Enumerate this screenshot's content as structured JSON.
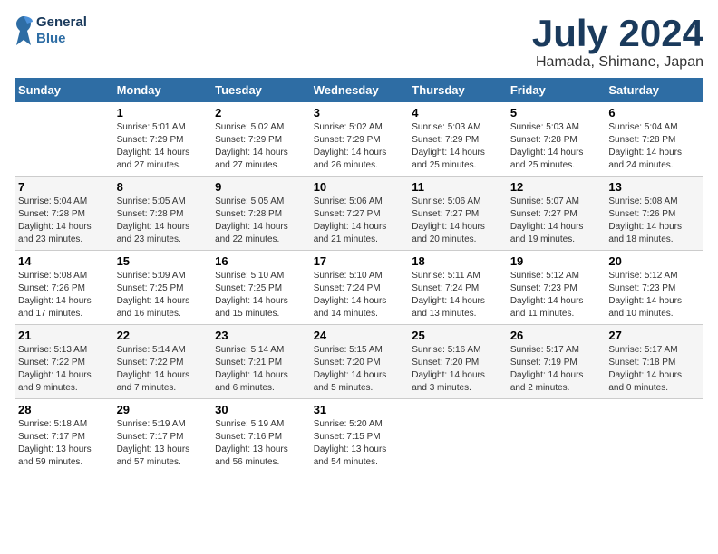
{
  "header": {
    "logo_line1": "General",
    "logo_line2": "Blue",
    "month_year": "July 2024",
    "location": "Hamada, Shimane, Japan"
  },
  "columns": [
    "Sunday",
    "Monday",
    "Tuesday",
    "Wednesday",
    "Thursday",
    "Friday",
    "Saturday"
  ],
  "weeks": [
    [
      {
        "day": "",
        "info": ""
      },
      {
        "day": "1",
        "info": "Sunrise: 5:01 AM\nSunset: 7:29 PM\nDaylight: 14 hours\nand 27 minutes."
      },
      {
        "day": "2",
        "info": "Sunrise: 5:02 AM\nSunset: 7:29 PM\nDaylight: 14 hours\nand 27 minutes."
      },
      {
        "day": "3",
        "info": "Sunrise: 5:02 AM\nSunset: 7:29 PM\nDaylight: 14 hours\nand 26 minutes."
      },
      {
        "day": "4",
        "info": "Sunrise: 5:03 AM\nSunset: 7:29 PM\nDaylight: 14 hours\nand 25 minutes."
      },
      {
        "day": "5",
        "info": "Sunrise: 5:03 AM\nSunset: 7:28 PM\nDaylight: 14 hours\nand 25 minutes."
      },
      {
        "day": "6",
        "info": "Sunrise: 5:04 AM\nSunset: 7:28 PM\nDaylight: 14 hours\nand 24 minutes."
      }
    ],
    [
      {
        "day": "7",
        "info": "Sunrise: 5:04 AM\nSunset: 7:28 PM\nDaylight: 14 hours\nand 23 minutes."
      },
      {
        "day": "8",
        "info": "Sunrise: 5:05 AM\nSunset: 7:28 PM\nDaylight: 14 hours\nand 23 minutes."
      },
      {
        "day": "9",
        "info": "Sunrise: 5:05 AM\nSunset: 7:28 PM\nDaylight: 14 hours\nand 22 minutes."
      },
      {
        "day": "10",
        "info": "Sunrise: 5:06 AM\nSunset: 7:27 PM\nDaylight: 14 hours\nand 21 minutes."
      },
      {
        "day": "11",
        "info": "Sunrise: 5:06 AM\nSunset: 7:27 PM\nDaylight: 14 hours\nand 20 minutes."
      },
      {
        "day": "12",
        "info": "Sunrise: 5:07 AM\nSunset: 7:27 PM\nDaylight: 14 hours\nand 19 minutes."
      },
      {
        "day": "13",
        "info": "Sunrise: 5:08 AM\nSunset: 7:26 PM\nDaylight: 14 hours\nand 18 minutes."
      }
    ],
    [
      {
        "day": "14",
        "info": "Sunrise: 5:08 AM\nSunset: 7:26 PM\nDaylight: 14 hours\nand 17 minutes."
      },
      {
        "day": "15",
        "info": "Sunrise: 5:09 AM\nSunset: 7:25 PM\nDaylight: 14 hours\nand 16 minutes."
      },
      {
        "day": "16",
        "info": "Sunrise: 5:10 AM\nSunset: 7:25 PM\nDaylight: 14 hours\nand 15 minutes."
      },
      {
        "day": "17",
        "info": "Sunrise: 5:10 AM\nSunset: 7:24 PM\nDaylight: 14 hours\nand 14 minutes."
      },
      {
        "day": "18",
        "info": "Sunrise: 5:11 AM\nSunset: 7:24 PM\nDaylight: 14 hours\nand 13 minutes."
      },
      {
        "day": "19",
        "info": "Sunrise: 5:12 AM\nSunset: 7:23 PM\nDaylight: 14 hours\nand 11 minutes."
      },
      {
        "day": "20",
        "info": "Sunrise: 5:12 AM\nSunset: 7:23 PM\nDaylight: 14 hours\nand 10 minutes."
      }
    ],
    [
      {
        "day": "21",
        "info": "Sunrise: 5:13 AM\nSunset: 7:22 PM\nDaylight: 14 hours\nand 9 minutes."
      },
      {
        "day": "22",
        "info": "Sunrise: 5:14 AM\nSunset: 7:22 PM\nDaylight: 14 hours\nand 7 minutes."
      },
      {
        "day": "23",
        "info": "Sunrise: 5:14 AM\nSunset: 7:21 PM\nDaylight: 14 hours\nand 6 minutes."
      },
      {
        "day": "24",
        "info": "Sunrise: 5:15 AM\nSunset: 7:20 PM\nDaylight: 14 hours\nand 5 minutes."
      },
      {
        "day": "25",
        "info": "Sunrise: 5:16 AM\nSunset: 7:20 PM\nDaylight: 14 hours\nand 3 minutes."
      },
      {
        "day": "26",
        "info": "Sunrise: 5:17 AM\nSunset: 7:19 PM\nDaylight: 14 hours\nand 2 minutes."
      },
      {
        "day": "27",
        "info": "Sunrise: 5:17 AM\nSunset: 7:18 PM\nDaylight: 14 hours\nand 0 minutes."
      }
    ],
    [
      {
        "day": "28",
        "info": "Sunrise: 5:18 AM\nSunset: 7:17 PM\nDaylight: 13 hours\nand 59 minutes."
      },
      {
        "day": "29",
        "info": "Sunrise: 5:19 AM\nSunset: 7:17 PM\nDaylight: 13 hours\nand 57 minutes."
      },
      {
        "day": "30",
        "info": "Sunrise: 5:19 AM\nSunset: 7:16 PM\nDaylight: 13 hours\nand 56 minutes."
      },
      {
        "day": "31",
        "info": "Sunrise: 5:20 AM\nSunset: 7:15 PM\nDaylight: 13 hours\nand 54 minutes."
      },
      {
        "day": "",
        "info": ""
      },
      {
        "day": "",
        "info": ""
      },
      {
        "day": "",
        "info": ""
      }
    ]
  ]
}
